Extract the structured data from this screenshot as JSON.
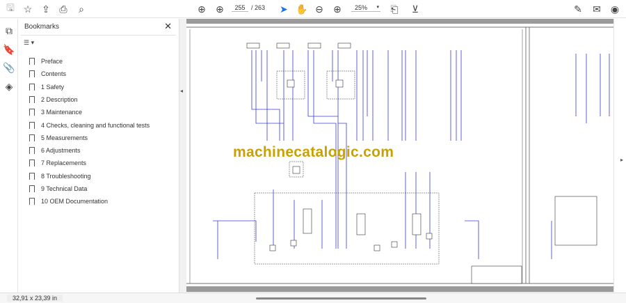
{
  "toolbar": {
    "page_current": "255",
    "page_total": "/ 263",
    "zoom": "25%"
  },
  "bookmarks": {
    "title": "Bookmarks",
    "items": [
      {
        "label": "Preface"
      },
      {
        "label": "Contents"
      },
      {
        "label": "1 Safety"
      },
      {
        "label": "2 Description"
      },
      {
        "label": "3 Maintenance"
      },
      {
        "label": "4 Checks, cleaning and functional tests"
      },
      {
        "label": "5 Measurements"
      },
      {
        "label": "6 Adjustments"
      },
      {
        "label": "7 Replacements"
      },
      {
        "label": "8 Troubleshooting"
      },
      {
        "label": "9 Technical Data"
      },
      {
        "label": "10 OEM Documentation"
      }
    ]
  },
  "document": {
    "watermark": "machinecatalogic.com"
  },
  "status": {
    "page_size": "32,91 x 23,39 in"
  },
  "colors": {
    "accent": "#1a73e8",
    "watermark": "#c9a200",
    "wire": "#3b3bd6"
  }
}
